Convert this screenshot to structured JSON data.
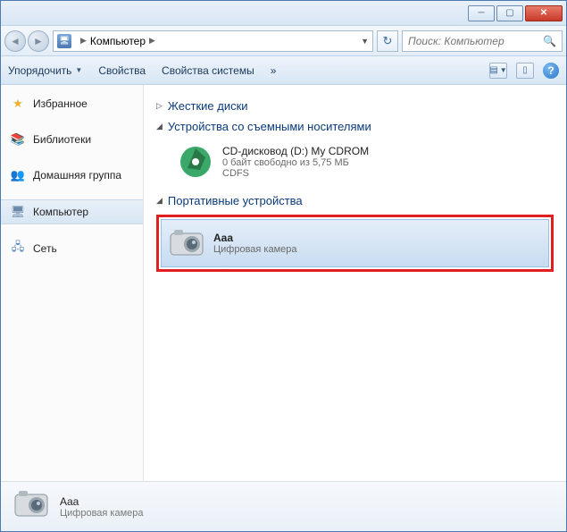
{
  "window": {
    "title": ""
  },
  "address": {
    "location": "Компьютер"
  },
  "search": {
    "placeholder": "Поиск: Компьютер"
  },
  "toolbar": {
    "organize": "Упорядочить",
    "properties": "Свойства",
    "system_properties": "Свойства системы",
    "more": "»"
  },
  "sidebar": {
    "favorites": "Избранное",
    "libraries": "Библиотеки",
    "homegroup": "Домашняя группа",
    "computer": "Компьютер",
    "network": "Сеть"
  },
  "groups": {
    "hard_drives": "Жесткие диски",
    "removable": "Устройства со съемными носителями",
    "portable": "Портативные устройства"
  },
  "items": {
    "cdrom": {
      "name": "CD-дисковод (D:) My CDROM",
      "free": "0 байт свободно из 5,75 МБ",
      "fs": "CDFS"
    },
    "camera": {
      "name": "Aaa",
      "type": "Цифровая камера"
    }
  },
  "details": {
    "name": "Aaa",
    "type": "Цифровая камера"
  }
}
